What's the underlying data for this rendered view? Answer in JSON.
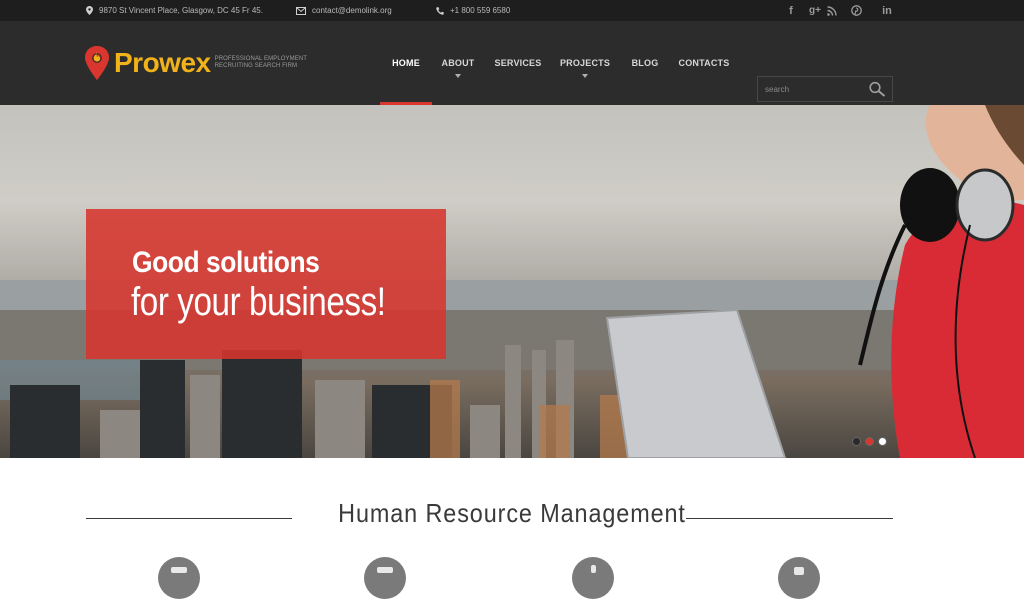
{
  "topbar": {
    "address": "9870 St Vincent Place, Glasgow, DC 45 Fr 45.",
    "email": "contact@demolink.org",
    "phone": "+1 800 559 6580",
    "social": [
      {
        "icon": "facebook-icon",
        "glyph": "f"
      },
      {
        "icon": "google-plus-icon",
        "glyph": "g+"
      },
      {
        "icon": "rss-icon",
        "glyph": "rss"
      },
      {
        "icon": "pinterest-icon",
        "glyph": "p"
      },
      {
        "icon": "linkedin-icon",
        "glyph": "in"
      }
    ]
  },
  "header": {
    "logo": "Prowex",
    "tagline_line1": "PROFESSIONAL EMPLOYMENT",
    "tagline_line2": "RECRUITING SEARCH FIRM",
    "nav": [
      {
        "label": "HOME",
        "active": true,
        "dropdown": false
      },
      {
        "label": "ABOUT",
        "active": false,
        "dropdown": true
      },
      {
        "label": "SERVICES",
        "active": false,
        "dropdown": false
      },
      {
        "label": "PROJECTS",
        "active": false,
        "dropdown": true
      },
      {
        "label": "BLOG",
        "active": false,
        "dropdown": false
      },
      {
        "label": "CONTACTS",
        "active": false,
        "dropdown": false
      }
    ],
    "search_placeholder": "search"
  },
  "hero": {
    "headline_line1": "Good solutions",
    "headline_line2": "for your business!",
    "slides": 3,
    "active_slide": 2
  },
  "section": {
    "title": "Human Resource Management"
  },
  "colors": {
    "accent": "#d9362f",
    "logo": "#f1b21a",
    "header_bg": "#2c2c2c",
    "topbar_bg": "#1e1e1e"
  }
}
